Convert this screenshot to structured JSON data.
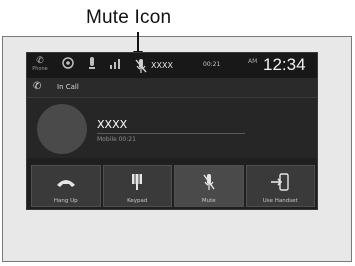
{
  "annotation": {
    "label": "Mute Icon"
  },
  "status_bar": {
    "icons": [
      {
        "name": "phone-menu-icon",
        "caption": "Phone"
      },
      {
        "name": "settings-icon",
        "caption": ""
      },
      {
        "name": "notifications-icon",
        "caption": ""
      }
    ],
    "mute_icon": "mute-microphone-icon",
    "caller_name": "XXXX",
    "call_timer": "00:21",
    "meridiem": "AM",
    "clock": "12:34"
  },
  "call_bar": {
    "label": "In Call"
  },
  "contact": {
    "name": "XXXX",
    "detail": "Mobile 00:21"
  },
  "buttons": [
    {
      "name": "hang-up-button",
      "icon": "hang-up-icon",
      "label": "Hang Up"
    },
    {
      "name": "keypad-button",
      "icon": "keypad-icon",
      "label": "Keypad"
    },
    {
      "name": "mute-button",
      "icon": "mute-icon",
      "label": "Mute"
    },
    {
      "name": "use-handset-button",
      "icon": "use-handset-icon",
      "label": "Use Handset"
    }
  ],
  "colors": {
    "screen_bg": "#1f1f1f",
    "button_bg": "#3a3a3a",
    "text": "#ffffff"
  }
}
